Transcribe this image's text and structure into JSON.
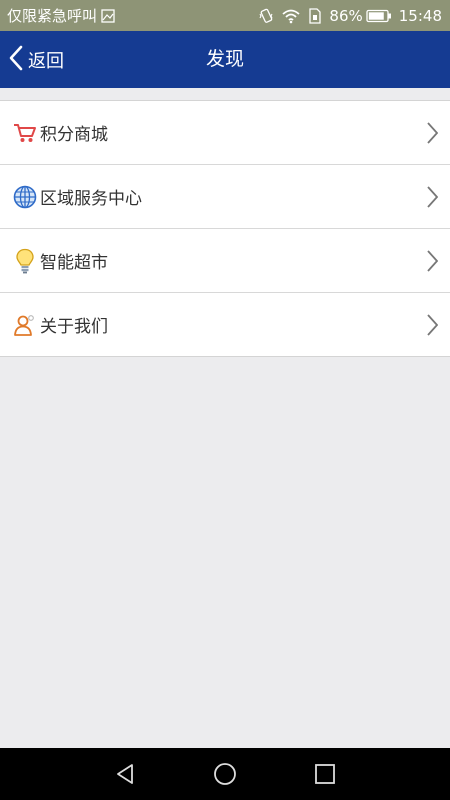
{
  "status_bar": {
    "carrier_text": "仅限紧急呼叫",
    "battery_percent": "86%",
    "battery_level": 0.86,
    "time": "15:48",
    "icons": [
      "image-notification-icon",
      "vibrate-icon",
      "wifi-icon",
      "sim-icon",
      "battery-icon"
    ]
  },
  "header": {
    "back_label": "返回",
    "title": "发现",
    "background_color": "#153b92"
  },
  "menu": {
    "items": [
      {
        "label": "积分商城",
        "icon": "shopping-cart-icon"
      },
      {
        "label": "区域服务中心",
        "icon": "globe-icon"
      },
      {
        "label": "智能超市",
        "icon": "lightbulb-icon"
      },
      {
        "label": "关于我们",
        "icon": "person-icon"
      }
    ]
  },
  "system_nav": {
    "buttons": [
      "back-triangle-icon",
      "home-circle-icon",
      "recents-square-icon"
    ]
  }
}
